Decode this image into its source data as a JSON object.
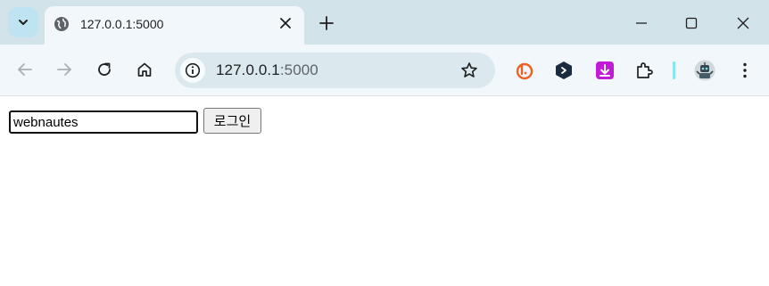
{
  "browser": {
    "tab": {
      "title": "127.0.0.1:5000"
    },
    "address_bar": {
      "host": "127.0.0.1",
      "port": ":5000"
    }
  },
  "page": {
    "username_input": {
      "value": "webnautes"
    },
    "login_button": {
      "label": "로그인"
    }
  },
  "icons": {
    "tab_search": "chevron-down-icon",
    "favicon": "globe-icon",
    "tab_close": "close-icon",
    "new_tab": "plus-icon",
    "minimize": "minimize-icon",
    "maximize": "maximize-icon",
    "window_close": "close-icon",
    "back": "back-arrow-icon",
    "forward": "forward-arrow-icon",
    "reload": "reload-icon",
    "home": "home-icon",
    "site_info": "info-icon",
    "bookmark": "star-icon",
    "extensions": [
      "bitly-extension-icon",
      "hex-extension-icon",
      "download-extension-icon",
      "puzzle-extensions-icon",
      "robot-profile-icon"
    ],
    "menu": "kebab-menu-icon"
  },
  "colors": {
    "tabstrip_bg": "#d3e3ea",
    "toolbar_bg": "#f1f7fa",
    "omnibox_bg": "#dbe9ef"
  }
}
